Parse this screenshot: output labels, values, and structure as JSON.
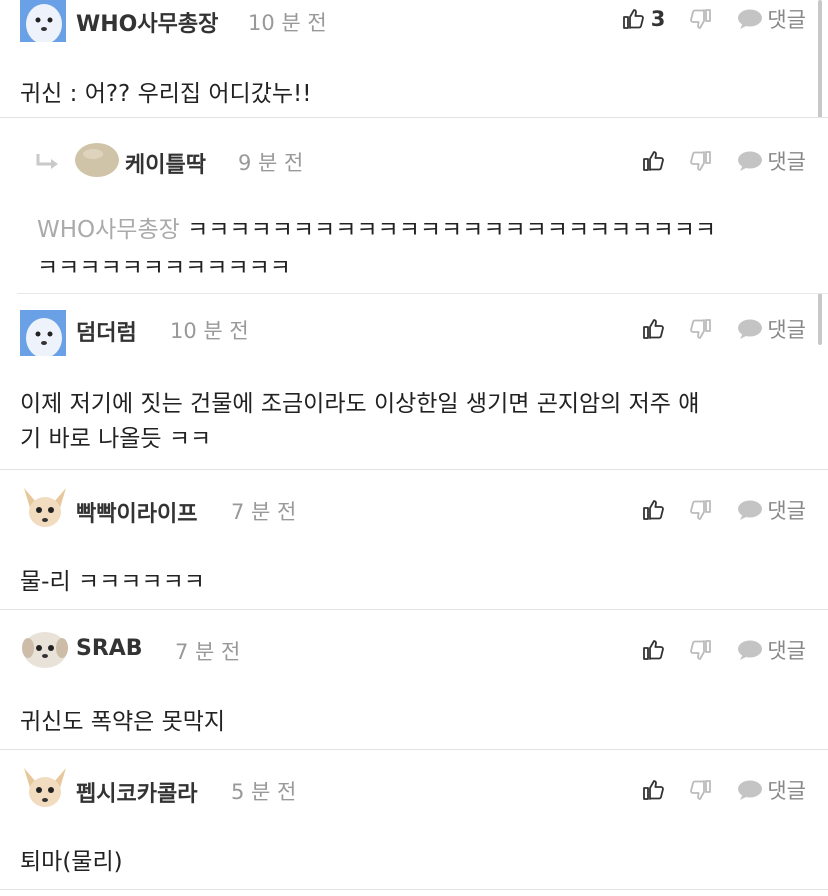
{
  "comments": [
    {
      "nick": "WHO사무총장",
      "time": "10 분 전",
      "likes": "3",
      "reply": "댓글",
      "text": "귀신 : 어?? 우리집 어디갔누!!"
    },
    {
      "nick": "케이틀딱",
      "time": "9 분 전",
      "reply": "댓글",
      "quote": "WHO사무총장",
      "text1": " ㅋㅋㅋㅋㅋㅋㅋㅋㅋㅋㅋㅋㅋㅋㅋㅋㅋㅋㅋㅋㅋㅋㅋㅋㅋ",
      "text2": "ㅋㅋㅋㅋㅋㅋㅋㅋㅋㅋㅋㅋ"
    },
    {
      "nick": "덤더럼",
      "time": "10 분 전",
      "reply": "댓글",
      "text1": "이제 저기에 짓는 건물에 조금이라도 이상한일 생기면 곤지암의 저주 얘",
      "text2": "기 바로 나올듯 ㅋㅋ"
    },
    {
      "nick": "빡빡이라이프",
      "time": "7 분 전",
      "reply": "댓글",
      "text": "물-리 ㅋㅋㅋㅋㅋㅋ"
    },
    {
      "nick": "SRAB",
      "time": "7 분 전",
      "reply": "댓글",
      "text": "귀신도 폭약은 못막지"
    },
    {
      "nick": "펩시코카콜라",
      "time": "5 분 전",
      "reply": "댓글",
      "text": "퇴마(물리)"
    }
  ],
  "colors": {
    "accent": "#333333",
    "muted": "#999999",
    "divider": "#e3e3e3"
  },
  "icons": [
    "thumbs-up-icon",
    "thumbs-down-icon",
    "speech-bubble-icon",
    "reply-arrow-icon"
  ]
}
